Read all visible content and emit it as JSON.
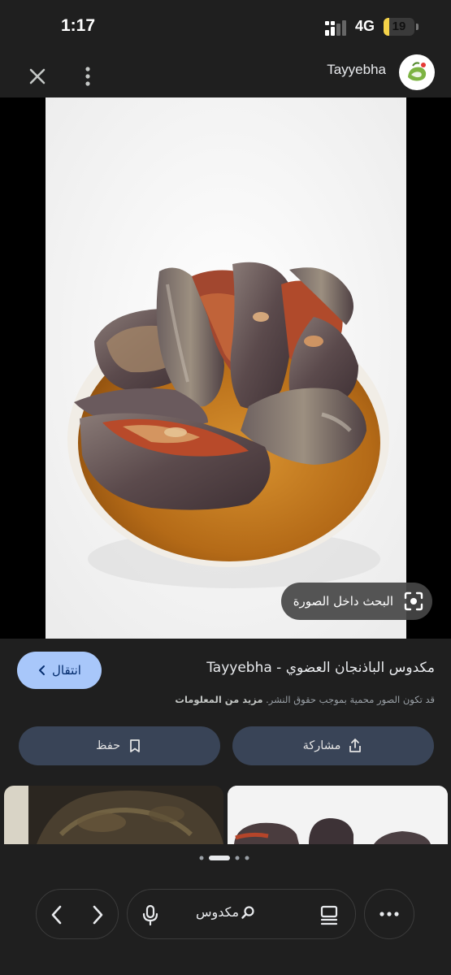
{
  "status_bar": {
    "time": "1:17",
    "network": "4G",
    "battery": "19",
    "battery_level": 0.19
  },
  "top_bar": {
    "site_name": "Tayyebha",
    "close_icon": "close-icon",
    "menu_icon": "more-vert-icon"
  },
  "viewer": {
    "lens_chip_label": "البحث داخل الصورة"
  },
  "result": {
    "title": "مكدوس الباذنجان العضوي - Tayyebha",
    "visit_label": "انتقال",
    "copyright_notice": "قد تكون الصور محمية بموجب حقوق النشر.",
    "learn_more": "مزيد من المعلومات",
    "share_label": "مشاركة",
    "save_label": "حفظ"
  },
  "bottom_bar": {
    "query": "مكدوس"
  },
  "colors": {
    "background": "#1f1f1f",
    "accent_button": "#a8c7fa",
    "pill_button": "#394457"
  }
}
